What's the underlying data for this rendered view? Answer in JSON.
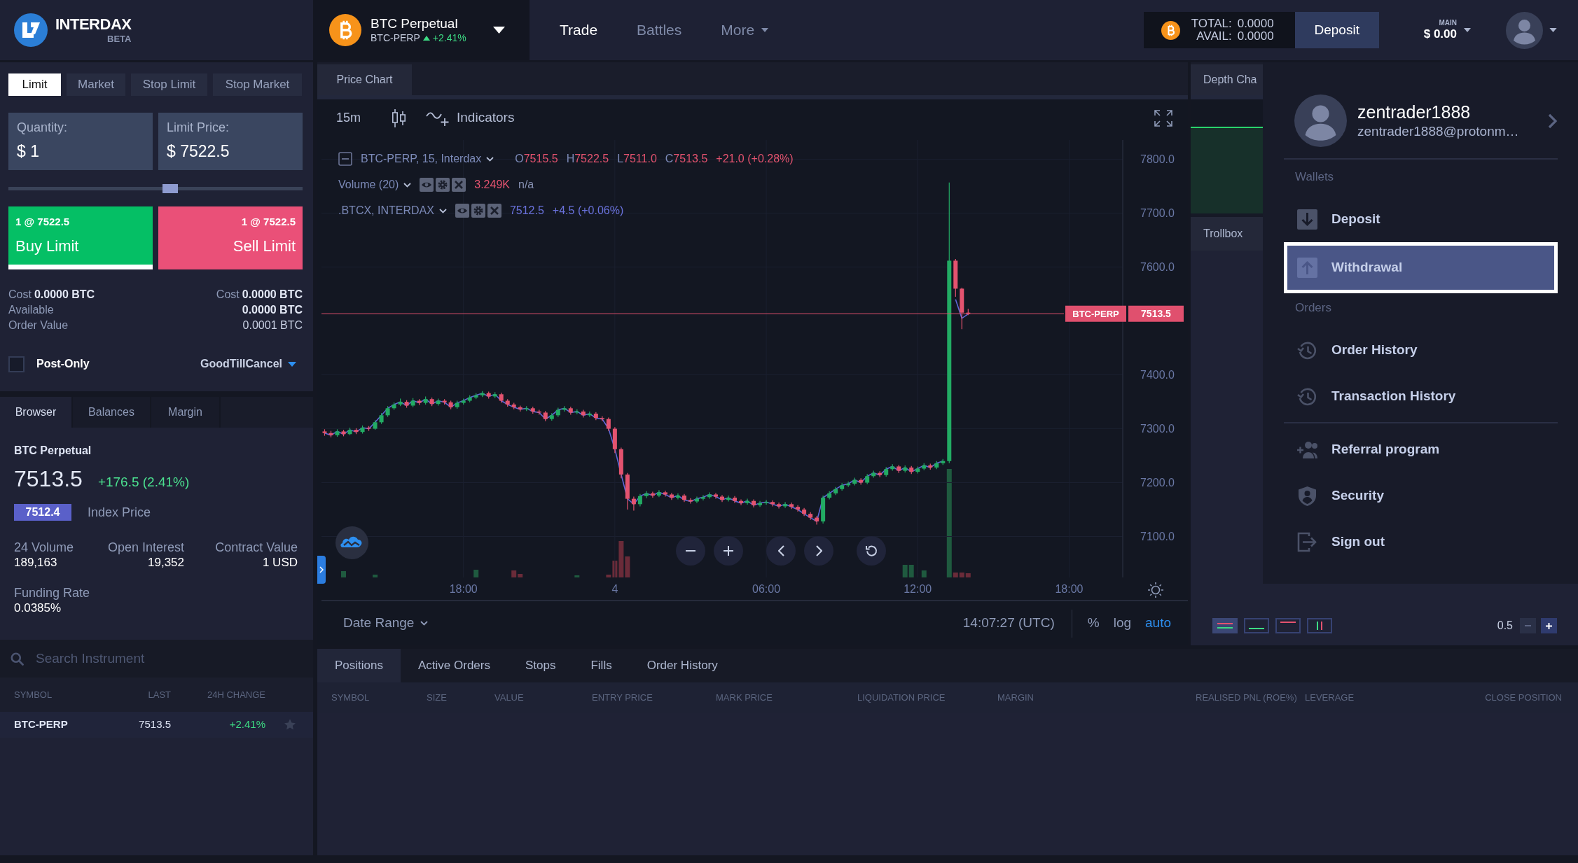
{
  "header": {
    "brand": "INTERDAX",
    "brand_tag": "BETA",
    "instrument": {
      "name": "BTC Perpetual",
      "symbol": "BTC-PERP",
      "change": "+2.41%"
    },
    "nav": [
      {
        "label": "Trade",
        "selected": true,
        "kind": "link"
      },
      {
        "label": "Battles",
        "selected": false,
        "kind": "link"
      },
      {
        "label": "More",
        "selected": false,
        "kind": "dropdown"
      }
    ],
    "balance": [
      {
        "label": "TOTAL:",
        "value": "0.0000"
      },
      {
        "label": "AVAIL:",
        "value": "0.0000"
      }
    ],
    "deposit": "Deposit",
    "account": {
      "label": "MAIN",
      "value": "$ 0.00"
    }
  },
  "order_form": {
    "tabs": [
      {
        "label": "Limit",
        "selected": true
      },
      {
        "label": "Market",
        "selected": false
      },
      {
        "label": "Stop Limit",
        "selected": false
      },
      {
        "label": "Stop Market",
        "selected": false
      }
    ],
    "fields": [
      {
        "label": "Quantity:",
        "value": "$ 1"
      },
      {
        "label": "Limit Price:",
        "value": "$ 7522.5"
      }
    ],
    "slider": {
      "level": 0.55
    },
    "actions": [
      {
        "kind": "buy",
        "detail": "1 @ 7522.5",
        "label": "Buy Limit",
        "selected": true
      },
      {
        "kind": "sell",
        "detail": "1 @ 7522.5",
        "label": "Sell Limit",
        "selected": false
      }
    ],
    "costs": [
      {
        "label": "Cost",
        "value": "0.0000 BTC"
      },
      {
        "label": "Cost",
        "value": "0.0000 BTC"
      }
    ],
    "summary": [
      {
        "label": "Available",
        "value": "0.0000 BTC",
        "bold": true
      },
      {
        "label": "Order Value",
        "value": "0.0001 BTC",
        "bold": false
      }
    ],
    "post_only": {
      "label": "Post-Only",
      "checked": false
    },
    "time_in_force": "GoodTillCancel"
  },
  "browser": {
    "tabs": [
      {
        "label": "Browser",
        "selected": true
      },
      {
        "label": "Balances",
        "selected": false
      },
      {
        "label": "Margin",
        "selected": false
      }
    ],
    "instrument": {
      "name": "BTC Perpetual",
      "last": "7513.5",
      "change": "+176.5 (2.41%)",
      "index_value": "7512.4",
      "index_label": "Index Price"
    },
    "stats": [
      {
        "label": "24 Volume",
        "value": "189,163"
      },
      {
        "label": "Open Interest",
        "value": "19,352"
      },
      {
        "label": "Contract Value",
        "value": "1 USD"
      }
    ],
    "funding": {
      "label": "Funding Rate",
      "value": "0.0385%"
    },
    "search": {
      "placeholder": "Search Instrument"
    },
    "table": {
      "columns": [
        "SYMBOL",
        "LAST",
        "24H CHANGE"
      ],
      "rows": [
        {
          "cells": [
            "BTC-PERP",
            "7513.5",
            "+2.41%"
          ],
          "starred": false
        }
      ]
    }
  },
  "price_chart": {
    "tab": {
      "label": "Price Chart",
      "selected": true
    },
    "interval": "15m",
    "indicators": "Indicators",
    "legend": [
      {
        "kind": "main",
        "title": "BTC-PERP, 15, Interdax",
        "color": "#e4536f",
        "values": [
          {
            "key": "O",
            "value": "7515.5",
            "muted": false
          },
          {
            "key": "H",
            "value": "7522.5",
            "muted": false
          },
          {
            "key": "L",
            "value": "7511.0",
            "muted": false
          },
          {
            "key": "C",
            "value": "7513.5",
            "muted": false
          },
          {
            "value": "+21.0 (+0.28%)",
            "muted": false
          }
        ]
      },
      {
        "kind": "study",
        "title": "Volume (20)",
        "color": "#e4536f",
        "values": [
          {
            "value": "3.249K",
            "muted": false
          },
          {
            "value": "n/a",
            "muted": true
          }
        ]
      },
      {
        "kind": "study",
        "title": ".BTCX, INTERDAX",
        "color": "#6a72dc",
        "values": [
          {
            "value": "7512.5",
            "muted": false
          },
          {
            "value": "+4.5 (+0.06%)",
            "muted": false
          }
        ]
      }
    ],
    "chart_data": [
      {
        "type": "candlestick",
        "categories": [
          null,
          null,
          null,
          null,
          null,
          null,
          null,
          null,
          null,
          null,
          null,
          null,
          null,
          null,
          null,
          null,
          null,
          null,
          null,
          null,
          null,
          null,
          "18:00",
          null,
          null,
          null,
          null,
          null,
          null,
          null,
          null,
          null,
          null,
          null,
          null,
          null,
          null,
          null,
          null,
          null,
          null,
          null,
          null,
          null,
          null,
          null,
          "4",
          null,
          null,
          null,
          null,
          null,
          null,
          null,
          null,
          null,
          null,
          null,
          null,
          null,
          null,
          null,
          null,
          null,
          null,
          null,
          null,
          null,
          null,
          null,
          "06:00",
          null,
          null,
          null,
          null,
          null,
          null,
          null,
          null,
          null,
          null,
          null,
          null,
          null,
          null,
          null,
          null,
          null,
          null,
          null,
          null,
          null,
          null,
          null,
          "12:00",
          null,
          null,
          null,
          null,
          null,
          null,
          null,
          null,
          null,
          null,
          null,
          null,
          null,
          null,
          null,
          null,
          null,
          null,
          null,
          null,
          null,
          null,
          null,
          "18:00",
          null,
          null,
          null,
          null,
          null,
          null,
          null,
          null
        ],
        "ohlc": [
          [
            7295,
            7299,
            7287,
            7292
          ],
          [
            7292,
            7296,
            7284,
            7288
          ],
          [
            7288,
            7299,
            7285,
            7295
          ],
          [
            7295,
            7298,
            7286,
            7290
          ],
          [
            7290,
            7302,
            7288,
            7298
          ],
          [
            7298,
            7301,
            7290,
            7294
          ],
          [
            7294,
            7306,
            7291,
            7302
          ],
          [
            7302,
            7305,
            7296,
            7300
          ],
          [
            7300,
            7316,
            7298,
            7312
          ],
          [
            7312,
            7329,
            7309,
            7325
          ],
          [
            7325,
            7342,
            7322,
            7338
          ],
          [
            7338,
            7349,
            7335,
            7345
          ],
          [
            7345,
            7356,
            7342,
            7350
          ],
          [
            7350,
            7353,
            7339,
            7343
          ],
          [
            7343,
            7357,
            7340,
            7352
          ],
          [
            7352,
            7355,
            7344,
            7348
          ],
          [
            7348,
            7360,
            7345,
            7355
          ],
          [
            7355,
            7358,
            7342,
            7346
          ],
          [
            7346,
            7356,
            7343,
            7352
          ],
          [
            7352,
            7355,
            7345,
            7349
          ],
          [
            7349,
            7352,
            7336,
            7340
          ],
          [
            7340,
            7352,
            7337,
            7348
          ],
          [
            7348,
            7356,
            7345,
            7352
          ],
          [
            7352,
            7362,
            7349,
            7358
          ],
          [
            7358,
            7366,
            7355,
            7362
          ],
          [
            7362,
            7370,
            7359,
            7366
          ],
          [
            7366,
            7369,
            7356,
            7360
          ],
          [
            7360,
            7368,
            7357,
            7364
          ],
          [
            7364,
            7367,
            7348,
            7352
          ],
          [
            7352,
            7355,
            7341,
            7345
          ],
          [
            7345,
            7348,
            7336,
            7340
          ],
          [
            7340,
            7343,
            7332,
            7336
          ],
          [
            7336,
            7342,
            7333,
            7338
          ],
          [
            7338,
            7341,
            7328,
            7332
          ],
          [
            7332,
            7335,
            7326,
            7330
          ],
          [
            7330,
            7333,
            7314,
            7318
          ],
          [
            7318,
            7329,
            7315,
            7325
          ],
          [
            7325,
            7339,
            7322,
            7335
          ],
          [
            7335,
            7342,
            7332,
            7338
          ],
          [
            7338,
            7341,
            7326,
            7330
          ],
          [
            7330,
            7336,
            7327,
            7332
          ],
          [
            7332,
            7335,
            7321,
            7325
          ],
          [
            7325,
            7332,
            7322,
            7328
          ],
          [
            7328,
            7331,
            7316,
            7320
          ],
          [
            7320,
            7323,
            7314,
            7318
          ],
          [
            7318,
            7321,
            7296,
            7300
          ],
          [
            7300,
            7303,
            7255,
            7262
          ],
          [
            7262,
            7265,
            7208,
            7215
          ],
          [
            7215,
            7218,
            7150,
            7170
          ],
          [
            7170,
            7174,
            7148,
            7160
          ],
          [
            7160,
            7179,
            7156,
            7175
          ],
          [
            7175,
            7184,
            7171,
            7180
          ],
          [
            7180,
            7183,
            7172,
            7176
          ],
          [
            7176,
            7186,
            7173,
            7182
          ],
          [
            7182,
            7185,
            7174,
            7178
          ],
          [
            7178,
            7181,
            7168,
            7172
          ],
          [
            7172,
            7180,
            7169,
            7176
          ],
          [
            7176,
            7179,
            7164,
            7168
          ],
          [
            7168,
            7171,
            7161,
            7165
          ],
          [
            7165,
            7174,
            7162,
            7170
          ],
          [
            7170,
            7177,
            7167,
            7173
          ],
          [
            7173,
            7182,
            7170,
            7178
          ],
          [
            7178,
            7181,
            7170,
            7174
          ],
          [
            7174,
            7177,
            7164,
            7168
          ],
          [
            7168,
            7176,
            7165,
            7172
          ],
          [
            7172,
            7175,
            7162,
            7166
          ],
          [
            7166,
            7169,
            7158,
            7162
          ],
          [
            7162,
            7170,
            7159,
            7166
          ],
          [
            7166,
            7169,
            7154,
            7158
          ],
          [
            7158,
            7166,
            7155,
            7162
          ],
          [
            7162,
            7168,
            7159,
            7164
          ],
          [
            7164,
            7167,
            7156,
            7160
          ],
          [
            7160,
            7163,
            7152,
            7156
          ],
          [
            7156,
            7164,
            7153,
            7160
          ],
          [
            7160,
            7163,
            7151,
            7155
          ],
          [
            7155,
            7158,
            7146,
            7150
          ],
          [
            7150,
            7153,
            7138,
            7142
          ],
          [
            7142,
            7145,
            7131,
            7135
          ],
          [
            7135,
            7138,
            7122,
            7128
          ],
          [
            7128,
            7176,
            7124,
            7172
          ],
          [
            7172,
            7184,
            7169,
            7180
          ],
          [
            7180,
            7192,
            7177,
            7188
          ],
          [
            7188,
            7199,
            7185,
            7195
          ],
          [
            7195,
            7202,
            7192,
            7198
          ],
          [
            7198,
            7209,
            7195,
            7205
          ],
          [
            7205,
            7208,
            7196,
            7200
          ],
          [
            7200,
            7216,
            7197,
            7212
          ],
          [
            7212,
            7222,
            7209,
            7218
          ],
          [
            7218,
            7221,
            7210,
            7214
          ],
          [
            7214,
            7229,
            7211,
            7225
          ],
          [
            7225,
            7234,
            7222,
            7230
          ],
          [
            7230,
            7233,
            7218,
            7222
          ],
          [
            7222,
            7232,
            7219,
            7228
          ],
          [
            7228,
            7231,
            7216,
            7220
          ],
          [
            7220,
            7230,
            7217,
            7226
          ],
          [
            7226,
            7236,
            7223,
            7232
          ],
          [
            7232,
            7235,
            7224,
            7228
          ],
          [
            7228,
            7240,
            7225,
            7236
          ],
          [
            7236,
            7244,
            7233,
            7240
          ],
          [
            7240,
            7757,
            7236,
            7612
          ],
          [
            7612,
            7615,
            7545,
            7560
          ],
          [
            7560,
            7562,
            7485,
            7515.5
          ],
          [
            7515.5,
            7522.5,
            7511,
            7513.5
          ],
          null,
          null,
          null,
          null,
          null,
          null,
          null,
          null,
          null,
          null,
          null,
          null,
          null,
          null,
          null,
          null,
          null,
          null,
          null,
          null,
          null,
          null,
          null,
          null
        ],
        "series": [
          {
            "type": "line",
            "color": "#5f68d8",
            "values": [
              7292,
              7288,
              7295,
              7290,
              7298,
              7294,
              7302,
              7300,
              7312,
              7325,
              7338,
              7345,
              7350,
              7343,
              7352,
              7348,
              7355,
              7346,
              7352,
              7349,
              7340,
              7348,
              7352,
              7358,
              7362,
              7366,
              7360,
              7364,
              7352,
              7345,
              7340,
              7336,
              7338,
              7332,
              7330,
              7318,
              7325,
              7335,
              7338,
              7330,
              7332,
              7325,
              7328,
              7320,
              7318,
              7300,
              7262,
              7215,
              7170,
              7160,
              7175,
              7180,
              7176,
              7182,
              7178,
              7172,
              7176,
              7168,
              7165,
              7170,
              7173,
              7178,
              7174,
              7168,
              7172,
              7166,
              7162,
              7166,
              7158,
              7162,
              7164,
              7160,
              7156,
              7160,
              7155,
              7150,
              7142,
              7135,
              7128,
              7172,
              7180,
              7188,
              7195,
              7198,
              7205,
              7200,
              7212,
              7218,
              7214,
              7225,
              7230,
              7222,
              7228,
              7220,
              7226,
              7232,
              7228,
              7236,
              7240,
              null,
              7540,
              7505,
              7513,
              null,
              null,
              null,
              null,
              null,
              null,
              null,
              null,
              null,
              null,
              null,
              null,
              null,
              null,
              null,
              null,
              null,
              null,
              null,
              null,
              null,
              null,
              null,
              null
            ]
          }
        ],
        "ylim": [
          7024,
          7836
        ],
        "yticks": [
          {
            "value": 7100,
            "label": "7100.0"
          },
          {
            "value": 7200,
            "label": "7200.0"
          },
          {
            "value": 7300,
            "label": "7300.0"
          },
          {
            "value": 7400,
            "label": "7400.0"
          },
          {
            "value": 7600,
            "label": "7600.0"
          },
          {
            "value": 7700,
            "label": "7700.0"
          },
          {
            "value": 7800,
            "label": "7800.0"
          }
        ],
        "ref_lines": [
          {
            "axis": "y",
            "value": 7513.5,
            "label": "BTC-PERP",
            "color": "#e0506e"
          }
        ],
        "annotations": [
          "7513.5"
        ],
        "grid": true
      }
    ],
    "date_range": "Date Range",
    "clock": "14:07:27 (UTC)",
    "scale_options": [
      {
        "label": "%",
        "selected": false
      },
      {
        "label": "log",
        "selected": false
      },
      {
        "label": "auto",
        "selected": true
      }
    ]
  },
  "right_panel": {
    "tabs": [
      {
        "label": "Depth Cha",
        "selected": true
      }
    ],
    "lower_tabs": [
      {
        "label": "Trollbox",
        "selected": true
      }
    ],
    "line_styles": [
      {
        "kind": "both",
        "selected": true
      },
      {
        "kind": "bids",
        "selected": false
      },
      {
        "kind": "asks",
        "selected": false
      },
      {
        "kind": "bars",
        "selected": false
      }
    ],
    "step": "0.5"
  },
  "account_menu": {
    "user": {
      "name": "zentrader1888",
      "email": "zentrader1888@protonm…"
    },
    "groups": [
      {
        "title": "Wallets",
        "items": [
          {
            "kind": "deposit",
            "label": "Deposit",
            "selected": false
          },
          {
            "kind": "withdrawal",
            "label": "Withdrawal",
            "selected": true
          }
        ]
      },
      {
        "title": "Orders",
        "items": [
          {
            "kind": "history",
            "label": "Order History",
            "selected": false
          },
          {
            "kind": "history",
            "label": "Transaction History",
            "selected": false
          }
        ]
      },
      {
        "items": [
          {
            "kind": "referral",
            "label": "Referral program",
            "selected": false
          },
          {
            "kind": "security",
            "label": "Security",
            "selected": false
          },
          {
            "kind": "signout",
            "label": "Sign out",
            "selected": false
          }
        ]
      }
    ]
  },
  "positions": {
    "tabs": [
      {
        "label": "Positions",
        "selected": true
      },
      {
        "label": "Active Orders",
        "selected": false
      },
      {
        "label": "Stops",
        "selected": false
      },
      {
        "label": "Fills",
        "selected": false
      },
      {
        "label": "Order History",
        "selected": false
      }
    ],
    "columns": [
      "SYMBOL",
      "SIZE",
      "VALUE",
      "ENTRY PRICE",
      "MARK PRICE",
      "LIQUIDATION PRICE",
      "MARGIN",
      "REALISED PNL (ROE%)",
      "LEVERAGE",
      "CLOSE POSITION"
    ]
  }
}
